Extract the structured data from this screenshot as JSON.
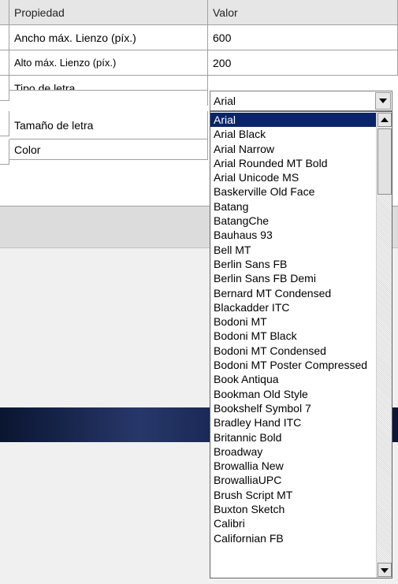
{
  "grid": {
    "header": {
      "property": "Propiedad",
      "value": "Valor"
    },
    "rows": [
      {
        "property": "Ancho máx. Lienzo (píx.)",
        "value": "600"
      },
      {
        "property": "Alto máx. Lienzo (píx.)",
        "value": "200"
      },
      {
        "property": "Tipo de letra",
        "value": "Arial"
      },
      {
        "property": "Tamaño de letra",
        "value": ""
      },
      {
        "property": "Color",
        "value": ""
      }
    ]
  },
  "combo": {
    "selected": "Arial"
  },
  "font_list": [
    "Arial",
    "Arial Black",
    "Arial Narrow",
    "Arial Rounded MT Bold",
    "Arial Unicode MS",
    "Baskerville Old Face",
    "Batang",
    "BatangChe",
    "Bauhaus 93",
    "Bell MT",
    "Berlin Sans FB",
    "Berlin Sans FB Demi",
    "Bernard MT Condensed",
    "Blackadder ITC",
    "Bodoni MT",
    "Bodoni MT Black",
    "Bodoni MT Condensed",
    "Bodoni MT Poster Compressed",
    "Book Antiqua",
    "Bookman Old Style",
    "Bookshelf Symbol 7",
    "Bradley Hand ITC",
    "Britannic Bold",
    "Broadway",
    "Browallia New",
    "BrowalliaUPC",
    "Brush Script MT",
    "Buxton Sketch",
    "Calibri",
    "Californian FB"
  ],
  "selected_index": 0,
  "colors": {
    "selection": "#0a246a",
    "grid_border": "#a0a0a0"
  }
}
